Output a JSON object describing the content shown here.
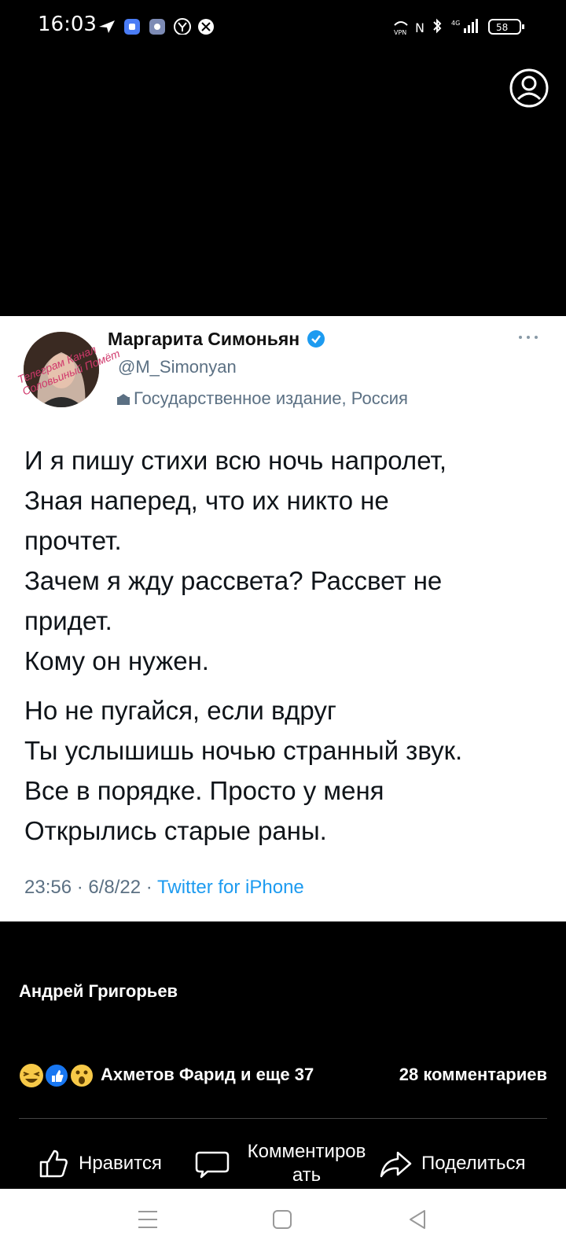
{
  "status_bar": {
    "time": "16:03",
    "battery": "58",
    "network": "4G"
  },
  "tweet": {
    "author": "Маргарита Симоньян",
    "verified": true,
    "handle": "@M_Simonyan",
    "label": "Государственное издание, Россия",
    "watermark_line1": "Телеграм Канал",
    "watermark_line2": "Соловьиный Помёт",
    "lines": [
      "И я пишу стихи всю ночь напролет,",
      "Зная наперед, что их никто не",
      "прочтет.",
      "Зачем я жду рассвета? Рассвет не",
      "придет.",
      "Кому он нужен."
    ],
    "lines2": [
      "Но не пугайся, если вдруг",
      "Ты услышишь ночью странный звук.",
      "Все в порядке. Просто у меня",
      "Открылись старые раны."
    ],
    "time": "23:56",
    "date": "6/8/22",
    "source": "Twitter for iPhone",
    "more": "···"
  },
  "post": {
    "poster": "Андрей Григорьев",
    "reactions_text": "Ахметов Фарид и еще 37",
    "comments_count": "28 комментариев",
    "like_label": "Нравится",
    "comment_label_1": "Комментиров",
    "comment_label_2": "ать",
    "share_label": "Поделиться"
  },
  "colors": {
    "like_blue": "#1877f2",
    "verified_blue": "#1d9bf0",
    "watermark_pink": "#d0386b"
  }
}
